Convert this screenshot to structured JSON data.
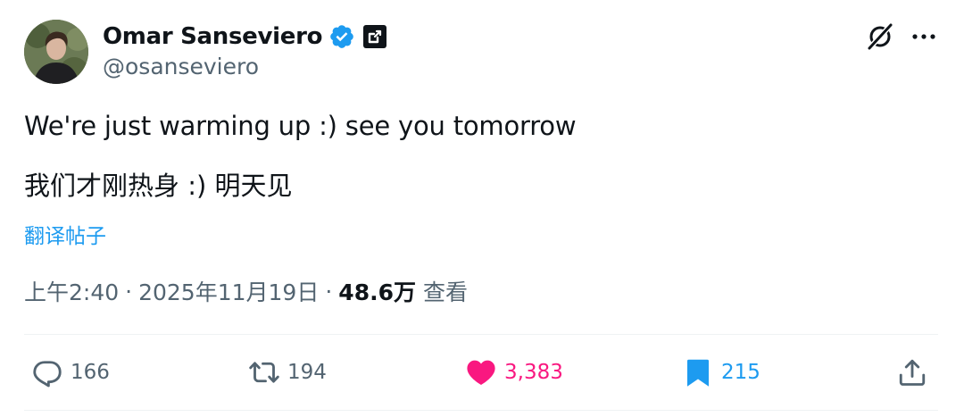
{
  "author": {
    "display_name": "Omar Sanseviero",
    "handle": "@osanseviero",
    "verified": true
  },
  "tweet": {
    "text_en": "We're just warming up :) see you tomorrow",
    "text_zh": "我们才刚热身 :) 明天见",
    "translate_label": "翻译帖子"
  },
  "meta": {
    "time": "上午2:40",
    "separator": "·",
    "date": "2025年11月19日",
    "views_count": "48.6万",
    "views_label": "查看"
  },
  "actions": {
    "replies": "166",
    "reposts": "194",
    "likes": "3,383",
    "bookmarks": "215"
  },
  "colors": {
    "link": "#1d9bf0",
    "like": "#f91880",
    "secondary_text": "#536471",
    "primary_text": "#0f1419"
  },
  "icons": [
    "verified-badge-icon",
    "affiliate-badge-icon",
    "grok-icon",
    "more-icon",
    "reply-icon",
    "repost-icon",
    "like-icon",
    "bookmark-icon",
    "share-icon"
  ]
}
